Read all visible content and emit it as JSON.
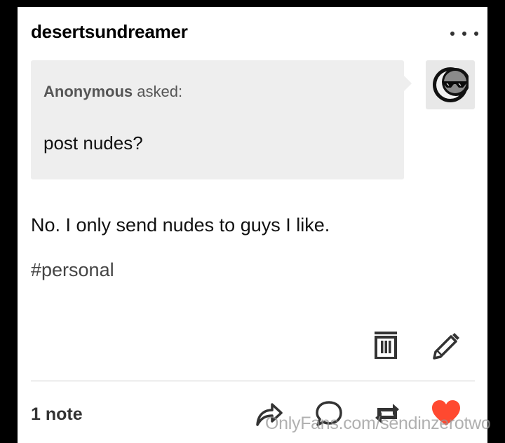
{
  "post": {
    "blog_name": "desertsundreamer",
    "ask": {
      "asker": "Anonymous",
      "asked_label": "asked:",
      "question": "post nudes?"
    },
    "answer": "No. I only send nudes to guys I like.",
    "tags": [
      "#personal"
    ],
    "notes": "1 note"
  },
  "icons": {
    "more": "more-options-icon",
    "avatar": "sunglasses-moon-avatar",
    "delete": "trash-icon",
    "edit": "pencil-icon",
    "share": "share-icon",
    "reply": "reply-bubble-icon",
    "reblog": "reblog-icon",
    "like": "heart-icon"
  },
  "colors": {
    "background": "#000000",
    "card": "#ffffff",
    "ask_bubble": "#eeeeee",
    "heart": "#ff4930"
  },
  "watermark": "OnlyFans.com/sendinzerotwo"
}
